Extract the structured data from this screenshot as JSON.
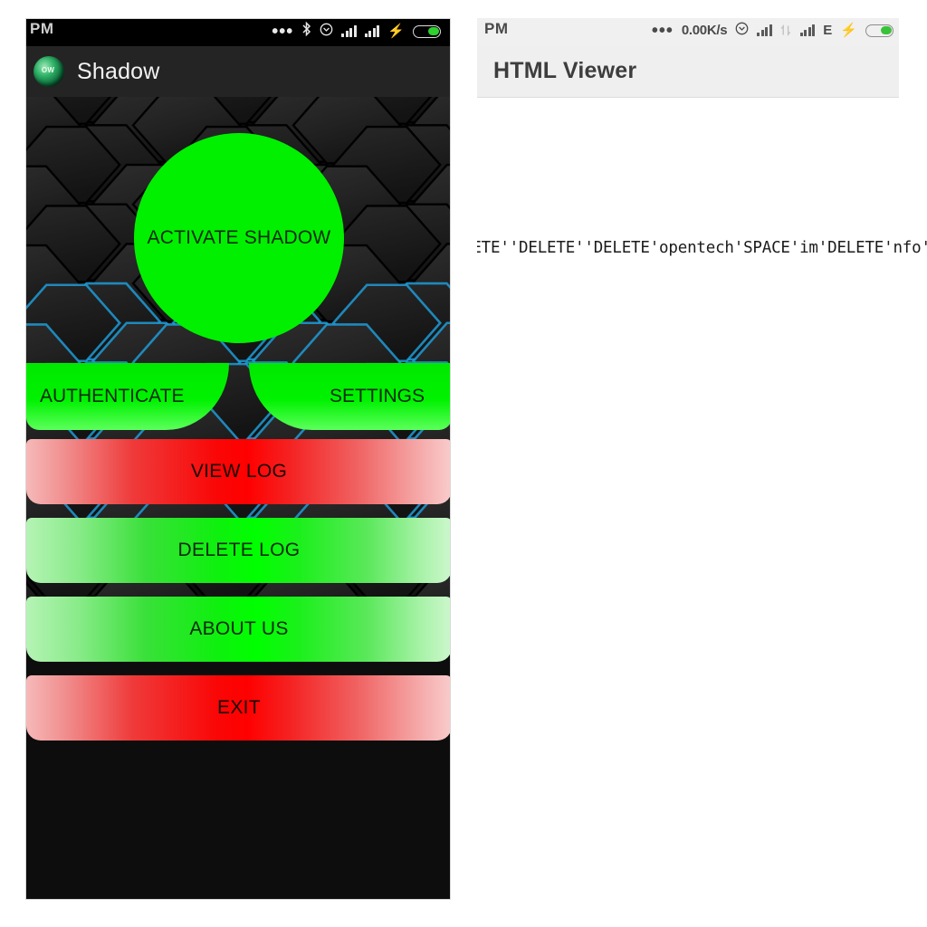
{
  "left_device": {
    "statusbar": {
      "time": "PM",
      "icons": [
        "more-dots-icon",
        "bluetooth-icon",
        "alarm-clock-icon",
        "signal-bars-icon",
        "signal-bars-icon",
        "charging-bolt-icon",
        "battery-icon"
      ]
    },
    "app": {
      "title": "Shadow",
      "logo_text": "OW"
    },
    "buttons": {
      "activate": "ACTIVATE SHADOW",
      "authenticate": "AUTHENTICATE",
      "settings": "SETTINGS",
      "view_log": "VIEW LOG",
      "delete_log": "DELETE LOG",
      "about_us": "ABOUT US",
      "exit": "EXIT"
    },
    "colors": {
      "accent_green": "#00FF00",
      "accent_red": "#FF0000",
      "background_dark": "#161616",
      "header_dark": "#242424",
      "hex_glow_blue": "#1E9BD7"
    }
  },
  "right_device": {
    "statusbar": {
      "time": "PM",
      "network_speed": "0.00K/s",
      "network_type": "E",
      "icons": [
        "more-dots-icon",
        "alarm-clock-icon",
        "signal-bars-icon",
        "data-transfer-icon",
        "signal-bars-icon",
        "charging-bolt-icon",
        "battery-icon"
      ]
    },
    "viewer": {
      "title": "HTML Viewer",
      "content_line": "'DELETE''DELETE''DELETE'opentech'SPACE'im'DELETE'nfo'ENTER'"
    },
    "colors": {
      "header_background": "#EFEFEF",
      "title_text": "#3D3D3D"
    }
  }
}
